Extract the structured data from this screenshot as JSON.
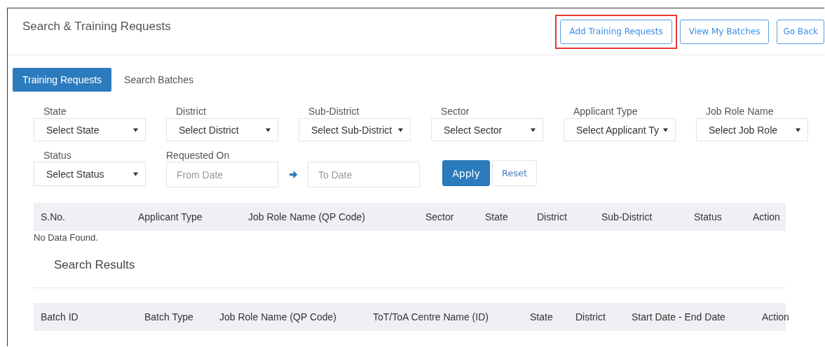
{
  "header": {
    "title": "Search & Training Requests",
    "buttons": [
      {
        "label": "Add Training Requests",
        "highlighted": true
      },
      {
        "label": "View My Batches",
        "highlighted": false
      },
      {
        "label": "Go Back",
        "highlighted": false
      }
    ]
  },
  "tabs": [
    {
      "label": "Training Requests",
      "selected": true
    },
    {
      "label": "Search Batches",
      "selected": false
    }
  ],
  "filters": [
    {
      "kind": "select",
      "label": "State",
      "placeholder": "Select State"
    },
    {
      "kind": "select",
      "label": "District",
      "placeholder": "Select District"
    },
    {
      "kind": "select",
      "label": "Sub-District",
      "placeholder": "Select Sub-District"
    },
    {
      "kind": "select",
      "label": "Sector",
      "placeholder": "Select Sector"
    },
    {
      "kind": "select",
      "label": "Applicant Type",
      "placeholder": "Select Applicant Ty"
    },
    {
      "kind": "select",
      "label": "Job Role Name",
      "placeholder": "Select Job Role"
    },
    {
      "kind": "select",
      "label": "Status",
      "placeholder": "Select Status"
    },
    {
      "kind": "daterange",
      "label": "Requested On",
      "from_placeholder": "From Date",
      "to_placeholder": "To Date"
    }
  ],
  "actions": {
    "apply": "Apply",
    "reset": "Reset"
  },
  "requests_table": {
    "columns": [
      "S.No.",
      "Applicant Type",
      "Job Role Name (QP Code)",
      "Sector",
      "State",
      "District",
      "Sub-District",
      "Status",
      "Action"
    ],
    "empty_message": "No Data Found."
  },
  "results": {
    "title": "Search Results",
    "columns": [
      "Batch ID",
      "Batch Type",
      "Job Role Name (QP Code)",
      "ToT/ToA Centre Name (ID)",
      "State",
      "District",
      "Start Date - End Date",
      "Action"
    ]
  }
}
